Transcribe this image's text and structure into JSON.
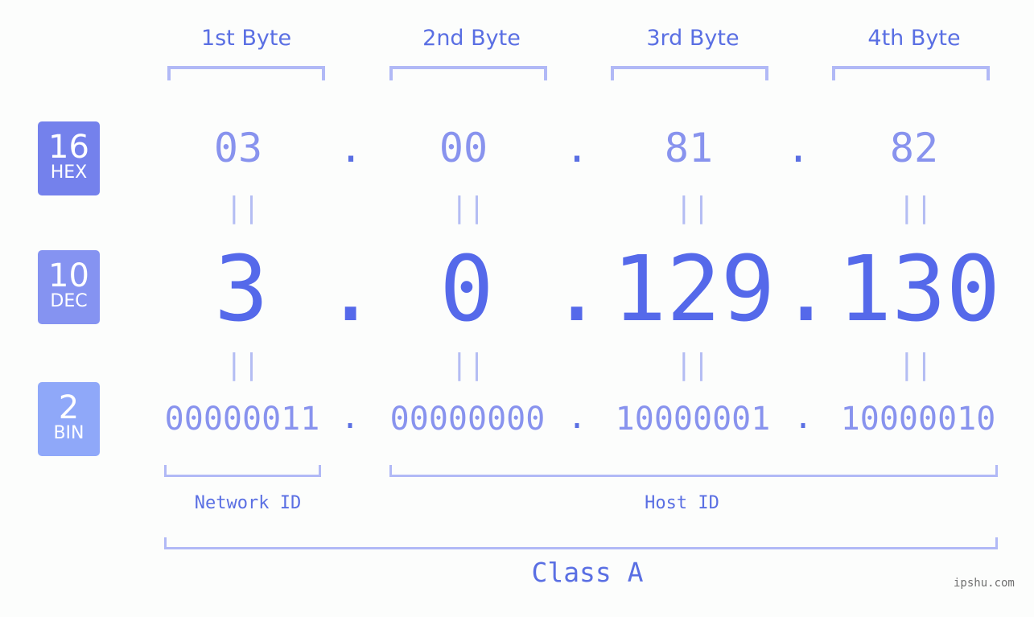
{
  "bytes": [
    {
      "label": "1st Byte",
      "hex": "03",
      "dec": "3",
      "bin": "00000011"
    },
    {
      "label": "2nd Byte",
      "hex": "00",
      "dec": "0",
      "bin": "00000000"
    },
    {
      "label": "3rd Byte",
      "hex": "81",
      "dec": "129",
      "bin": "10000001"
    },
    {
      "label": "4th Byte",
      "hex": "82",
      "dec": "130",
      "bin": "10000010"
    }
  ],
  "separator": ".",
  "equals": "||",
  "badges": {
    "hex": {
      "num": "16",
      "label": "HEX",
      "color": "#7481ec"
    },
    "dec": {
      "num": "10",
      "label": "DEC",
      "color": "#8593f1"
    },
    "bin": {
      "num": "2",
      "label": "BIN",
      "color": "#8fa8f9"
    }
  },
  "network_id_label": "Network ID",
  "host_id_label": "Host ID",
  "class_label": "Class A",
  "watermark": "ipshu.com"
}
